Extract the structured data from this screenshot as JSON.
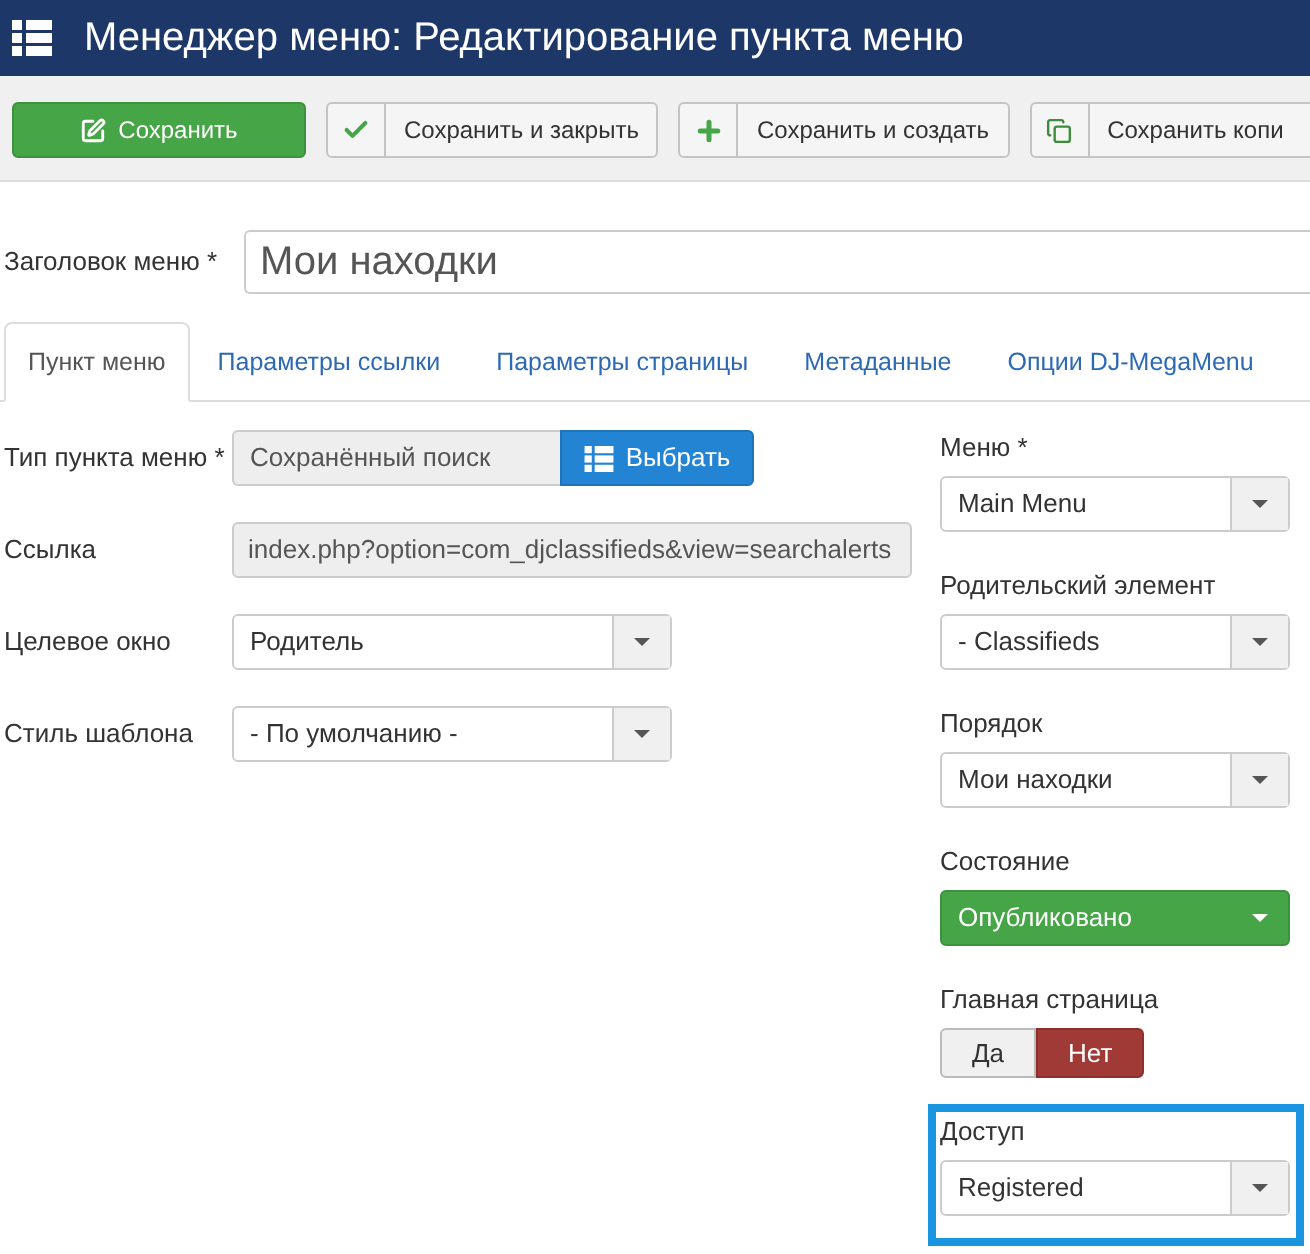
{
  "header": {
    "title": "Менеджер меню: Редактирование пункта меню"
  },
  "toolbar": [
    {
      "label": "Сохранить",
      "kind": "save"
    },
    {
      "label": "Сохранить и закрыть",
      "kind": "close"
    },
    {
      "label": "Сохранить и создать",
      "kind": "new"
    },
    {
      "label": "Сохранить копи",
      "kind": "copy"
    }
  ],
  "title_field": {
    "label": "Заголовок меню",
    "required_mark": "*",
    "value": "Мои находки"
  },
  "tabs": [
    {
      "label": "Пункт меню",
      "selected": true
    },
    {
      "label": "Параметры ссылки",
      "selected": false
    },
    {
      "label": "Параметры страницы",
      "selected": false
    },
    {
      "label": "Метаданные",
      "selected": false
    },
    {
      "label": "Опции DJ-MegaMenu",
      "selected": false
    }
  ],
  "left_fields": [
    {
      "label": "Тип пункта меню",
      "required_mark": "*",
      "kind": "picker",
      "value": "Сохранённый поиск",
      "button": "Выбрать"
    },
    {
      "label": "Ссылка",
      "kind": "readonly",
      "value": "index.php?option=com_djclassifieds&view=searchalerts"
    },
    {
      "label": "Целевое окно",
      "kind": "select",
      "value": "Родитель"
    },
    {
      "label": "Стиль шаблона",
      "kind": "select",
      "value": "- По умолчанию -"
    }
  ],
  "right_fields": [
    {
      "label": "Меню",
      "required_mark": "*",
      "kind": "select",
      "value": "Main Menu",
      "highlighted": false
    },
    {
      "label": "Родительский элемент",
      "kind": "select",
      "value": "- Classifieds",
      "highlighted": false
    },
    {
      "label": "Порядок",
      "kind": "select",
      "value": "Мои находки",
      "highlighted": false
    },
    {
      "label": "Состояние",
      "kind": "status",
      "value": "Опубликовано",
      "highlighted": false
    },
    {
      "label": "Главная страница",
      "kind": "toggle",
      "options": [
        {
          "label": "Да",
          "selected": false
        },
        {
          "label": "Нет",
          "selected": true
        }
      ],
      "highlighted": false
    },
    {
      "label": "Доступ",
      "kind": "select",
      "value": "Registered",
      "highlighted": true
    }
  ]
}
